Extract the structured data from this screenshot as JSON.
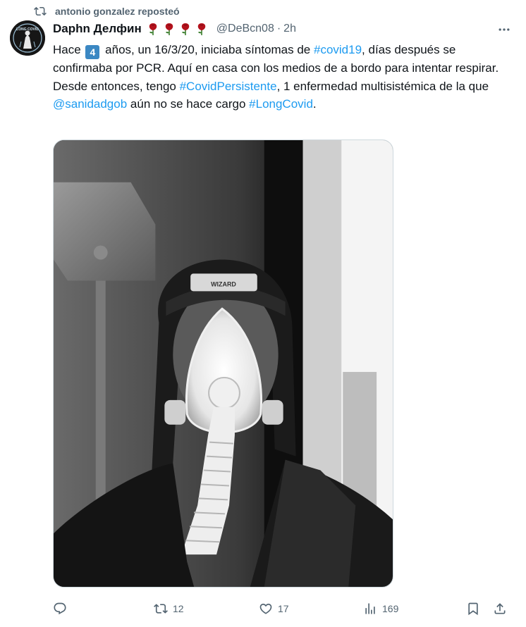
{
  "repost": {
    "text": "antonio gonzalez reposteó",
    "icon": "repost-icon"
  },
  "author": {
    "name": "Daphn Делфин",
    "emoji": [
      "rose",
      "rose",
      "rose",
      "rose"
    ],
    "handle": "@DeBcn08",
    "separator": "·",
    "time": "2h",
    "avatar_text": "LONG COVID"
  },
  "tweet": {
    "line1_a": "Hace",
    "keycap": "4",
    "line1_b": "años, un 16/3/20, iniciaba síntomas de",
    "hashtag1": "#covid19",
    "line1_c": ", días después se confirmaba por PCR. Aquí en casa con los medios de a bordo para intentar respirar.",
    "line2_a": "Desde entonces, tengo",
    "hashtag2": "#CovidPersistente",
    "line2_b": ", 1 enfermedad multisistémica de la que",
    "mention": "@sanidadgob",
    "line2_c": "aún no se hace cargo",
    "hashtag3": "#LongCovid",
    "line2_d": ".",
    "mask_brand": "WIZARD"
  },
  "actions": {
    "reply": {
      "icon": "reply-icon",
      "count": ""
    },
    "retweet": {
      "icon": "retweet-icon",
      "count": "12"
    },
    "like": {
      "icon": "heart-icon",
      "count": "17"
    },
    "views": {
      "icon": "views-icon",
      "count": "169"
    },
    "bookmark": {
      "icon": "bookmark-icon"
    },
    "share": {
      "icon": "share-icon"
    }
  },
  "colors": {
    "link": "#1d9bf0",
    "muted": "#536471",
    "text": "#0f1419",
    "keycap": "#3b88c3"
  }
}
